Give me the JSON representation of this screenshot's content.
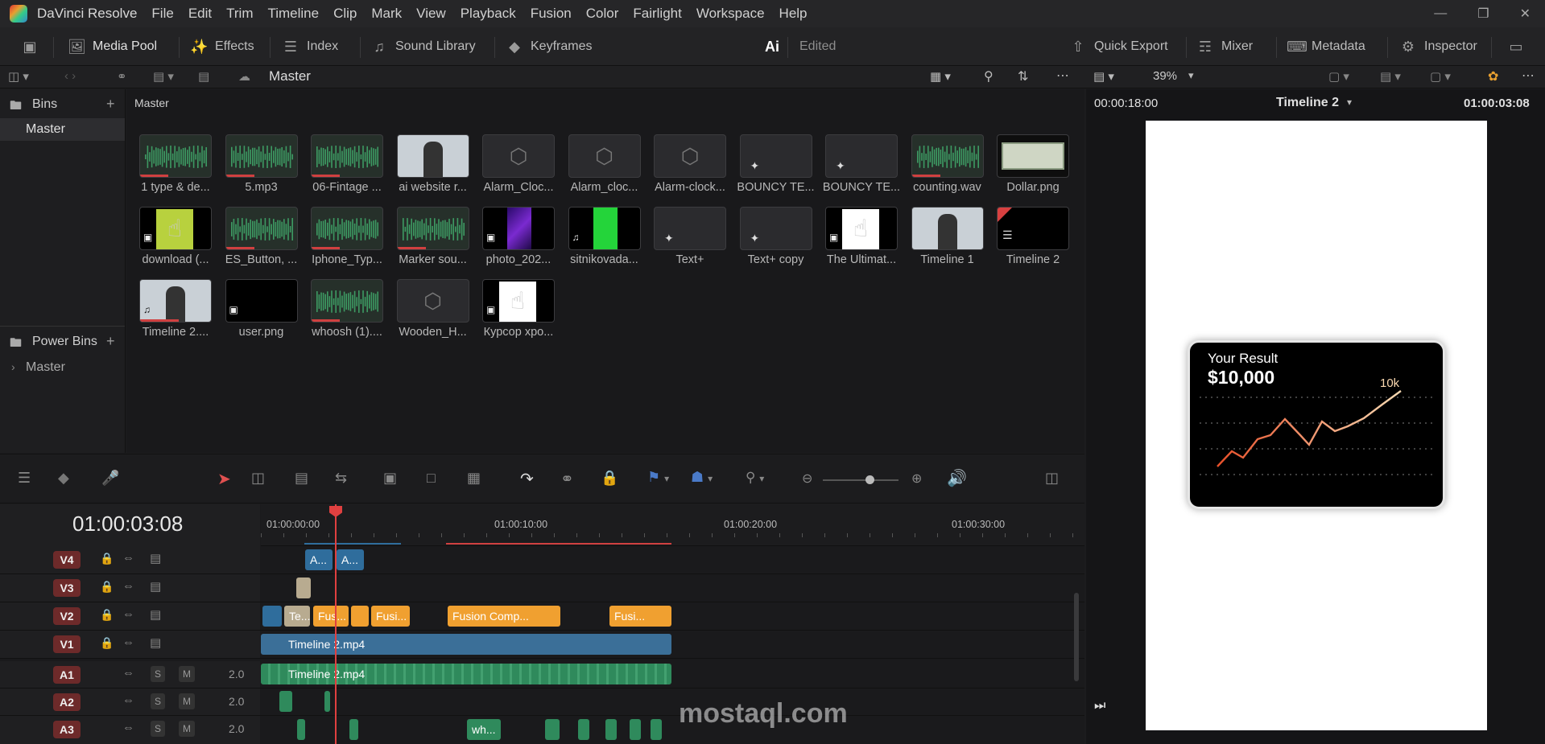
{
  "app": {
    "title": "DaVinci Resolve"
  },
  "menu": [
    "File",
    "Edit",
    "Trim",
    "Timeline",
    "Clip",
    "Mark",
    "View",
    "Playback",
    "Fusion",
    "Color",
    "Fairlight",
    "Workspace",
    "Help"
  ],
  "toolbar": {
    "media_pool": "Media Pool",
    "effects": "Effects",
    "index": "Index",
    "sound_library": "Sound Library",
    "keyframes": "Keyframes",
    "ai": "Ai",
    "edited": "Edited",
    "quick_export": "Quick Export",
    "mixer": "Mixer",
    "metadata": "Metadata",
    "inspector": "Inspector"
  },
  "bar2": {
    "bin_name": "Master",
    "zoom": "39%"
  },
  "bins": {
    "header": "Bins",
    "items": [
      "Master"
    ],
    "power_bins": "Power Bins",
    "power_items": [
      "Master"
    ]
  },
  "pool": {
    "breadcrumb": "Master",
    "clips": [
      {
        "label": "1 type & de...",
        "kind": "audio"
      },
      {
        "label": "5.mp3",
        "kind": "audio"
      },
      {
        "label": "06-Fintage ...",
        "kind": "audio"
      },
      {
        "label": "ai website r...",
        "kind": "video"
      },
      {
        "label": "Alarm_Cloc...",
        "kind": "cube"
      },
      {
        "label": "Alarm_cloc...",
        "kind": "cube"
      },
      {
        "label": "Alarm-clock...",
        "kind": "cube"
      },
      {
        "label": "BOUNCY TE...",
        "kind": "fusion"
      },
      {
        "label": "BOUNCY TE...",
        "kind": "fusion"
      },
      {
        "label": "counting.wav",
        "kind": "audio"
      },
      {
        "label": "Dollar.png",
        "kind": "dollar"
      },
      {
        "label": "download (...",
        "kind": "hand-green"
      },
      {
        "label": "ES_Button, ...",
        "kind": "audio"
      },
      {
        "label": "Iphone_Typ...",
        "kind": "audio"
      },
      {
        "label": "Marker sou...",
        "kind": "audio"
      },
      {
        "label": "photo_202...",
        "kind": "purple"
      },
      {
        "label": "sitnikovada...",
        "kind": "greenscreen"
      },
      {
        "label": "Text+",
        "kind": "fusion"
      },
      {
        "label": "Text+ copy",
        "kind": "fusion"
      },
      {
        "label": "The Ultimat...",
        "kind": "hand-white"
      },
      {
        "label": "Timeline 1",
        "kind": "video"
      },
      {
        "label": "Timeline 2",
        "kind": "timeline"
      },
      {
        "label": "Timeline 2....",
        "kind": "video-audio"
      },
      {
        "label": "user.png",
        "kind": "image"
      },
      {
        "label": "whoosh (1)....",
        "kind": "audio"
      },
      {
        "label": "Wooden_H...",
        "kind": "cube"
      },
      {
        "label": "Курсор хро...",
        "kind": "hand-white"
      }
    ]
  },
  "viewer": {
    "src_timecode": "00:00:18:00",
    "timeline_name": "Timeline 2",
    "rec_timecode": "01:00:03:08",
    "card": {
      "caption": "Your Result",
      "amount": "$10,000",
      "peak": "10k"
    }
  },
  "timeline": {
    "timecode": "01:00:03:08",
    "ruler": [
      "01:00:00:00",
      "01:00:10:00",
      "01:00:20:00",
      "01:00:30:00"
    ],
    "video_tracks": [
      "V4",
      "V3",
      "V2",
      "V1"
    ],
    "audio_tracks": [
      {
        "name": "A1",
        "level": "2.0"
      },
      {
        "name": "A2",
        "level": "2.0"
      },
      {
        "name": "A3",
        "level": "2.0"
      }
    ],
    "clips": {
      "v4a": "A...",
      "v4b": "A...",
      "v2a": "Te...",
      "v2b": "Fus...",
      "v2c": "Fusi...",
      "v2d": "Fusion Comp...",
      "v2e": "Fusi...",
      "v1": "Timeline 2.mp4",
      "a1": "Timeline 2.mp4",
      "a3": "wh..."
    },
    "track_buttons": {
      "solo": "S",
      "mute": "M"
    }
  },
  "watermark": {
    "text": "mostaql.com"
  },
  "colors": {
    "accent_orange": "#f0a030",
    "playhead": "#e04040",
    "video_clip": "#2f6d9c",
    "audio_clip": "#2f8a5c"
  }
}
